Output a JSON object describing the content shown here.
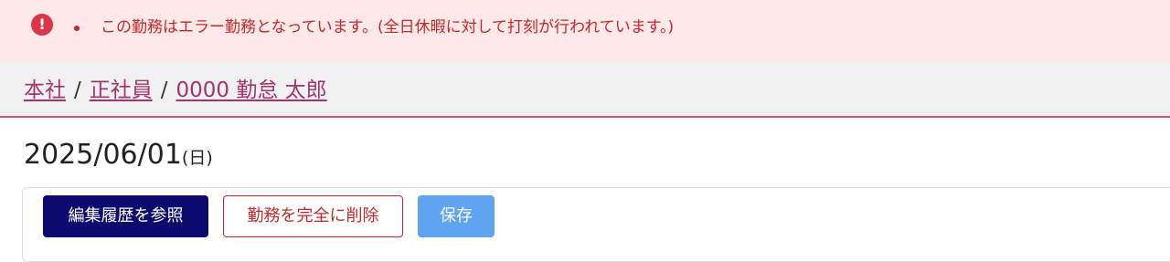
{
  "alert": {
    "icon": "exclamation-circle-icon",
    "color": "#d93748",
    "background": "#fde8ea",
    "icon_glyph": "!",
    "message": "この勤務はエラー勤務となっています。(全日休暇に対して打刻が行われています。)"
  },
  "breadcrumb": {
    "items": [
      {
        "label": "本社"
      },
      {
        "label": "正社員"
      },
      {
        "label": "0000 勤怠 太郎"
      }
    ],
    "separator": "/",
    "link_color": "#a4346d"
  },
  "date": {
    "value": "2025/06/01",
    "day_of_week": "(日)"
  },
  "toolbar": {
    "history_label": "編集履歴を参照",
    "delete_label": "勤務を完全に削除",
    "save_label": "保存",
    "history_color": "#0c0a6e",
    "delete_color": "#c2272d",
    "save_color": "#5fa4ef"
  }
}
